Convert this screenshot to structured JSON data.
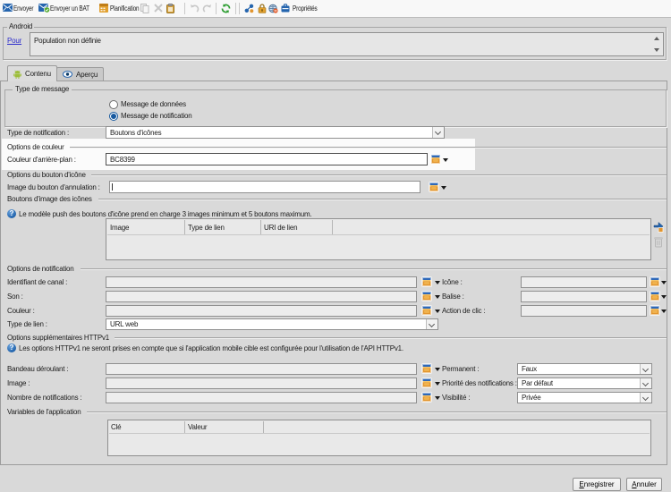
{
  "toolbar": {
    "send": "Envoyer",
    "send_proof": "Envoyer un BAT",
    "schedule": "Planification",
    "properties": "Propriétés"
  },
  "audience": {
    "group_title": "Android",
    "target_link": "Pour",
    "population": "Population non définie"
  },
  "tabs": {
    "content": "Contenu",
    "preview": "Aperçu"
  },
  "form": {
    "message_type": {
      "legend": "Type de message",
      "radio_data": "Message de données",
      "radio_notification": "Message de notification"
    },
    "notification_type": {
      "label": "Type de notification :",
      "value": "Boutons d'icônes"
    },
    "color_options": {
      "legend": "Options de couleur",
      "background_color_label": "Couleur d'arrière-plan :",
      "background_color_value": "BC8399"
    },
    "icon_button_options": {
      "legend": "Options du bouton d'icône",
      "cancel_image_label": "Image du bouton d'annulation :",
      "cancel_image_value": ""
    },
    "icon_image_buttons": {
      "legend": "Boutons d'image des icônes",
      "info": "Le modèle push des boutons d'icône prend en charge 3 images minimum et 5 boutons maximum.",
      "columns": [
        "Image",
        "Type de lien",
        "URI de lien"
      ]
    },
    "notification_options": {
      "legend": "Options de notification",
      "channel_id_label": "Identifiant de canal :",
      "icon_label": "Icône :",
      "sound_label": "Son :",
      "tag_label": "Balise :",
      "color_label": "Couleur :",
      "click_action_label": "Action de clic :",
      "link_type_label": "Type de lien :",
      "link_type_value": "URL web"
    },
    "httpv1_options": {
      "legend": "Options supplémentaires HTTPv1",
      "info": "Les options HTTPv1 ne seront prises en compte que si l'application mobile cible est configurée pour l'utilisation de l'API HTTPv1.",
      "ticker_label": "Bandeau déroulant :",
      "sticky_label": "Permanent :",
      "sticky_value": "Faux",
      "image_label": "Image :",
      "priority_label": "Priorité des notifications :",
      "priority_value": "Par défaut",
      "count_label": "Nombre de notifications :",
      "visibility_label": "Visibilité :",
      "visibility_value": "Privée"
    },
    "app_variables": {
      "legend": "Variables de l'application",
      "columns": [
        "Clé",
        "Valeur"
      ]
    }
  },
  "footer": {
    "save": "Enregistrer",
    "cancel": "Annuler"
  },
  "colors": {
    "accent_blue": "#2e68b8",
    "accent_orange": "#e2952e",
    "background": "#d9d9d9",
    "panel_white": "#fbfbfb",
    "link_blue": "#2d2dcc",
    "android_green": "#9dbe3a",
    "refresh_green": "#2f9e33"
  }
}
